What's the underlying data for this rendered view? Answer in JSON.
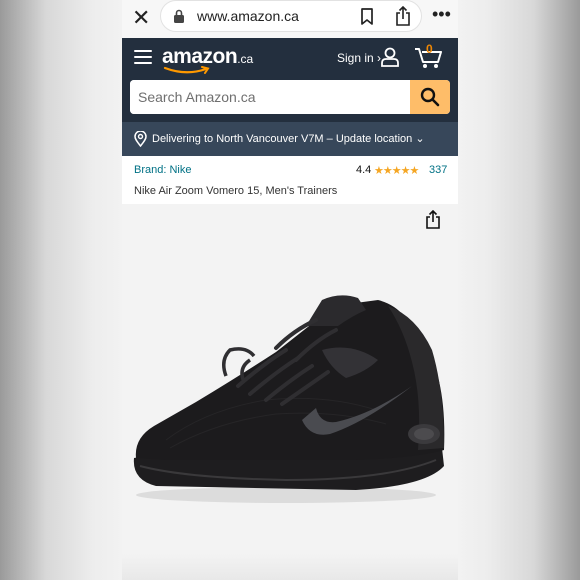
{
  "browser": {
    "url": "www.amazon.ca"
  },
  "header": {
    "logo_text": "amazon",
    "logo_tld": ".ca",
    "signin_label": "Sign in ›",
    "cart_count": "0"
  },
  "search": {
    "placeholder": "Search Amazon.ca"
  },
  "delivery": {
    "text": "Delivering to North Vancouver V7M – Update location ⌄"
  },
  "product": {
    "brand": "Brand: Nike",
    "rating": "4.4",
    "stars": "★★★★★",
    "rating_count": "337",
    "title": "Nike Air Zoom Vomero 15, Men's Trainers"
  },
  "colors": {
    "header_bg": "#232f3e",
    "delivery_bg": "#37475a",
    "search_button": "#febd69",
    "link": "#007185",
    "star": "#f5a623"
  },
  "icons": [
    "close-icon",
    "lock-icon",
    "bookmark-icon",
    "share-icon",
    "more-icon",
    "menu-icon",
    "user-icon",
    "cart-icon",
    "search-icon",
    "location-pin-icon"
  ]
}
